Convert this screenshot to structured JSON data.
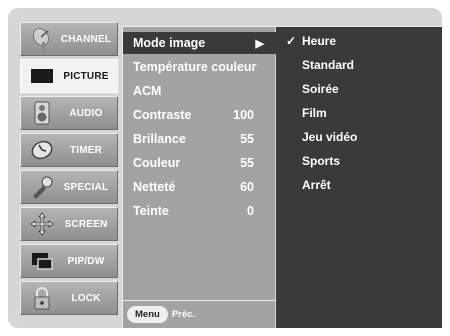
{
  "sidebar": {
    "items": [
      {
        "label": "CHANNEL",
        "icon": "satellite-dish-icon"
      },
      {
        "label": "PICTURE",
        "icon": "tv-screen-icon"
      },
      {
        "label": "AUDIO",
        "icon": "speaker-icon"
      },
      {
        "label": "TIMER",
        "icon": "clock-icon"
      },
      {
        "label": "SPECIAL",
        "icon": "tool-icon"
      },
      {
        "label": "SCREEN",
        "icon": "arrows-icon"
      },
      {
        "label": "PIP/DW",
        "icon": "pip-icon"
      },
      {
        "label": "LOCK",
        "icon": "padlock-icon"
      }
    ],
    "active": "PICTURE"
  },
  "picture_menu": {
    "rows": [
      {
        "label": "Mode image",
        "value": "",
        "arrow": "▶"
      },
      {
        "label": "Température couleur",
        "value": ""
      },
      {
        "label": "ACM",
        "value": ""
      },
      {
        "label": "Contraste",
        "value": "100"
      },
      {
        "label": "Brillance",
        "value": "55"
      },
      {
        "label": "Couleur",
        "value": "55"
      },
      {
        "label": "Netteté",
        "value": "60"
      },
      {
        "label": "Teinte",
        "value": "0"
      }
    ]
  },
  "footer": {
    "menu_button": "Menu",
    "prev_label": "Préc."
  },
  "mode_options": {
    "check_mark": "✓",
    "items": [
      "Heure",
      "Standard",
      "Soirée",
      "Film",
      "Jeu vidéo",
      "Sports",
      "Arrêt"
    ],
    "selected": "Heure"
  },
  "colors": {
    "panel": "#d6d6d6",
    "highlight": "#3a3a3a",
    "menu_bg": "#a3a3a3"
  }
}
